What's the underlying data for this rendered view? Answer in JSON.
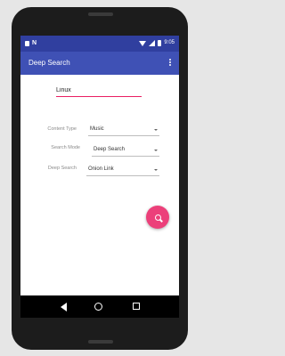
{
  "status_bar": {
    "time": "9:05"
  },
  "app_bar": {
    "title": "Deep Search"
  },
  "search": {
    "value": "Linux"
  },
  "settings": [
    {
      "label": "Content Type",
      "value": "Music"
    },
    {
      "label": "Search Mode",
      "value": "Deep Search"
    },
    {
      "label": "Deep Search",
      "value": "Onion Link"
    }
  ],
  "colors": {
    "primary": "#3f51b5",
    "primary_dark": "#303f9f",
    "accent": "#e91e63",
    "fab": "#ec407a"
  },
  "icons": {
    "fab": "search-icon",
    "nav": [
      "back-icon",
      "home-icon",
      "recents-icon"
    ]
  }
}
